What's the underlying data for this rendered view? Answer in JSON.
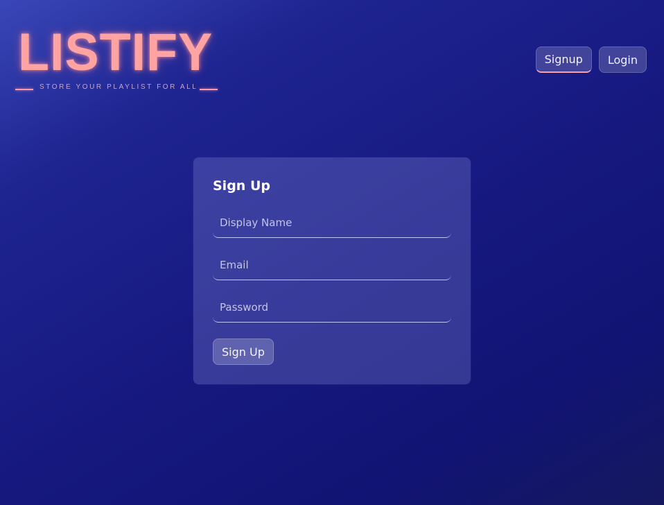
{
  "logo": {
    "title": "LISTIFY",
    "tagline": "STORE YOUR PLAYLIST FOR ALL"
  },
  "nav": {
    "signup_label": "Signup",
    "login_label": "Login"
  },
  "form": {
    "title": "Sign Up",
    "display_name_placeholder": "Display Name",
    "email_placeholder": "Email",
    "password_placeholder": "Password",
    "submit_label": "Sign Up"
  },
  "colors": {
    "accent": "#ffa3a3",
    "background": "#16187f"
  }
}
